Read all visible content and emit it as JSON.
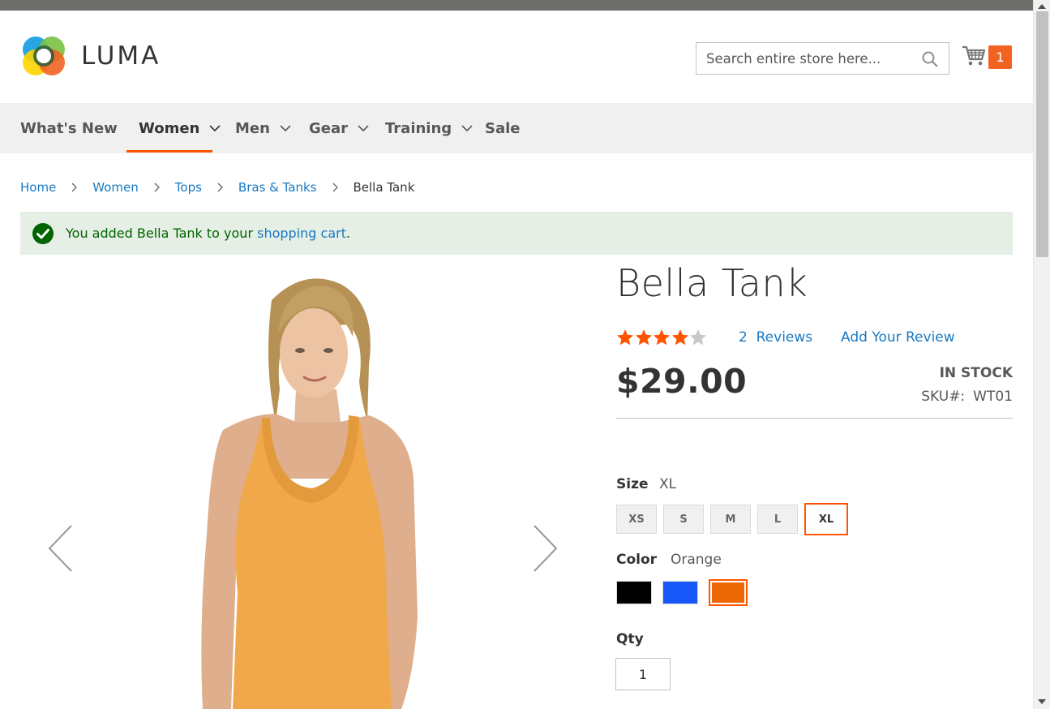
{
  "header": {
    "logo_text": "LUMA",
    "search": {
      "placeholder": "Search entire store here..."
    },
    "cart": {
      "count": "1"
    }
  },
  "nav": {
    "items": [
      {
        "label": "What's New",
        "has_dropdown": false
      },
      {
        "label": "Women",
        "has_dropdown": true,
        "active": true
      },
      {
        "label": "Men",
        "has_dropdown": true
      },
      {
        "label": "Gear",
        "has_dropdown": true
      },
      {
        "label": "Training",
        "has_dropdown": true
      },
      {
        "label": "Sale",
        "has_dropdown": false
      }
    ]
  },
  "breadcrumbs": [
    {
      "label": "Home",
      "link": true
    },
    {
      "label": "Women",
      "link": true
    },
    {
      "label": "Tops",
      "link": true
    },
    {
      "label": "Bras & Tanks",
      "link": true
    },
    {
      "label": "Bella Tank",
      "link": false
    }
  ],
  "message": {
    "prefix": "You added Bella Tank to your ",
    "link": "shopping cart",
    "suffix": "."
  },
  "product": {
    "name": "Bella Tank",
    "rating": {
      "filled": 4,
      "total": 5
    },
    "reviews_link": "2  Reviews",
    "add_review": "Add Your Review",
    "price": "$29.00",
    "stock": "IN STOCK",
    "sku_label": "SKU#:",
    "sku": "WT01",
    "size": {
      "label": "Size",
      "selected": "XL",
      "options": [
        "XS",
        "S",
        "M",
        "L",
        "XL"
      ]
    },
    "color": {
      "label": "Color",
      "selected": "Orange",
      "options": [
        {
          "name": "Black",
          "hex": "#000000"
        },
        {
          "name": "Blue",
          "hex": "#1857f7"
        },
        {
          "name": "Orange",
          "hex": "#eb6703"
        }
      ]
    },
    "qty": {
      "label": "Qty",
      "value": "1"
    }
  },
  "colors": {
    "accent": "#ff5501",
    "link": "#1979c3",
    "star": "#ff5501",
    "success_bg": "#e5efe5"
  }
}
